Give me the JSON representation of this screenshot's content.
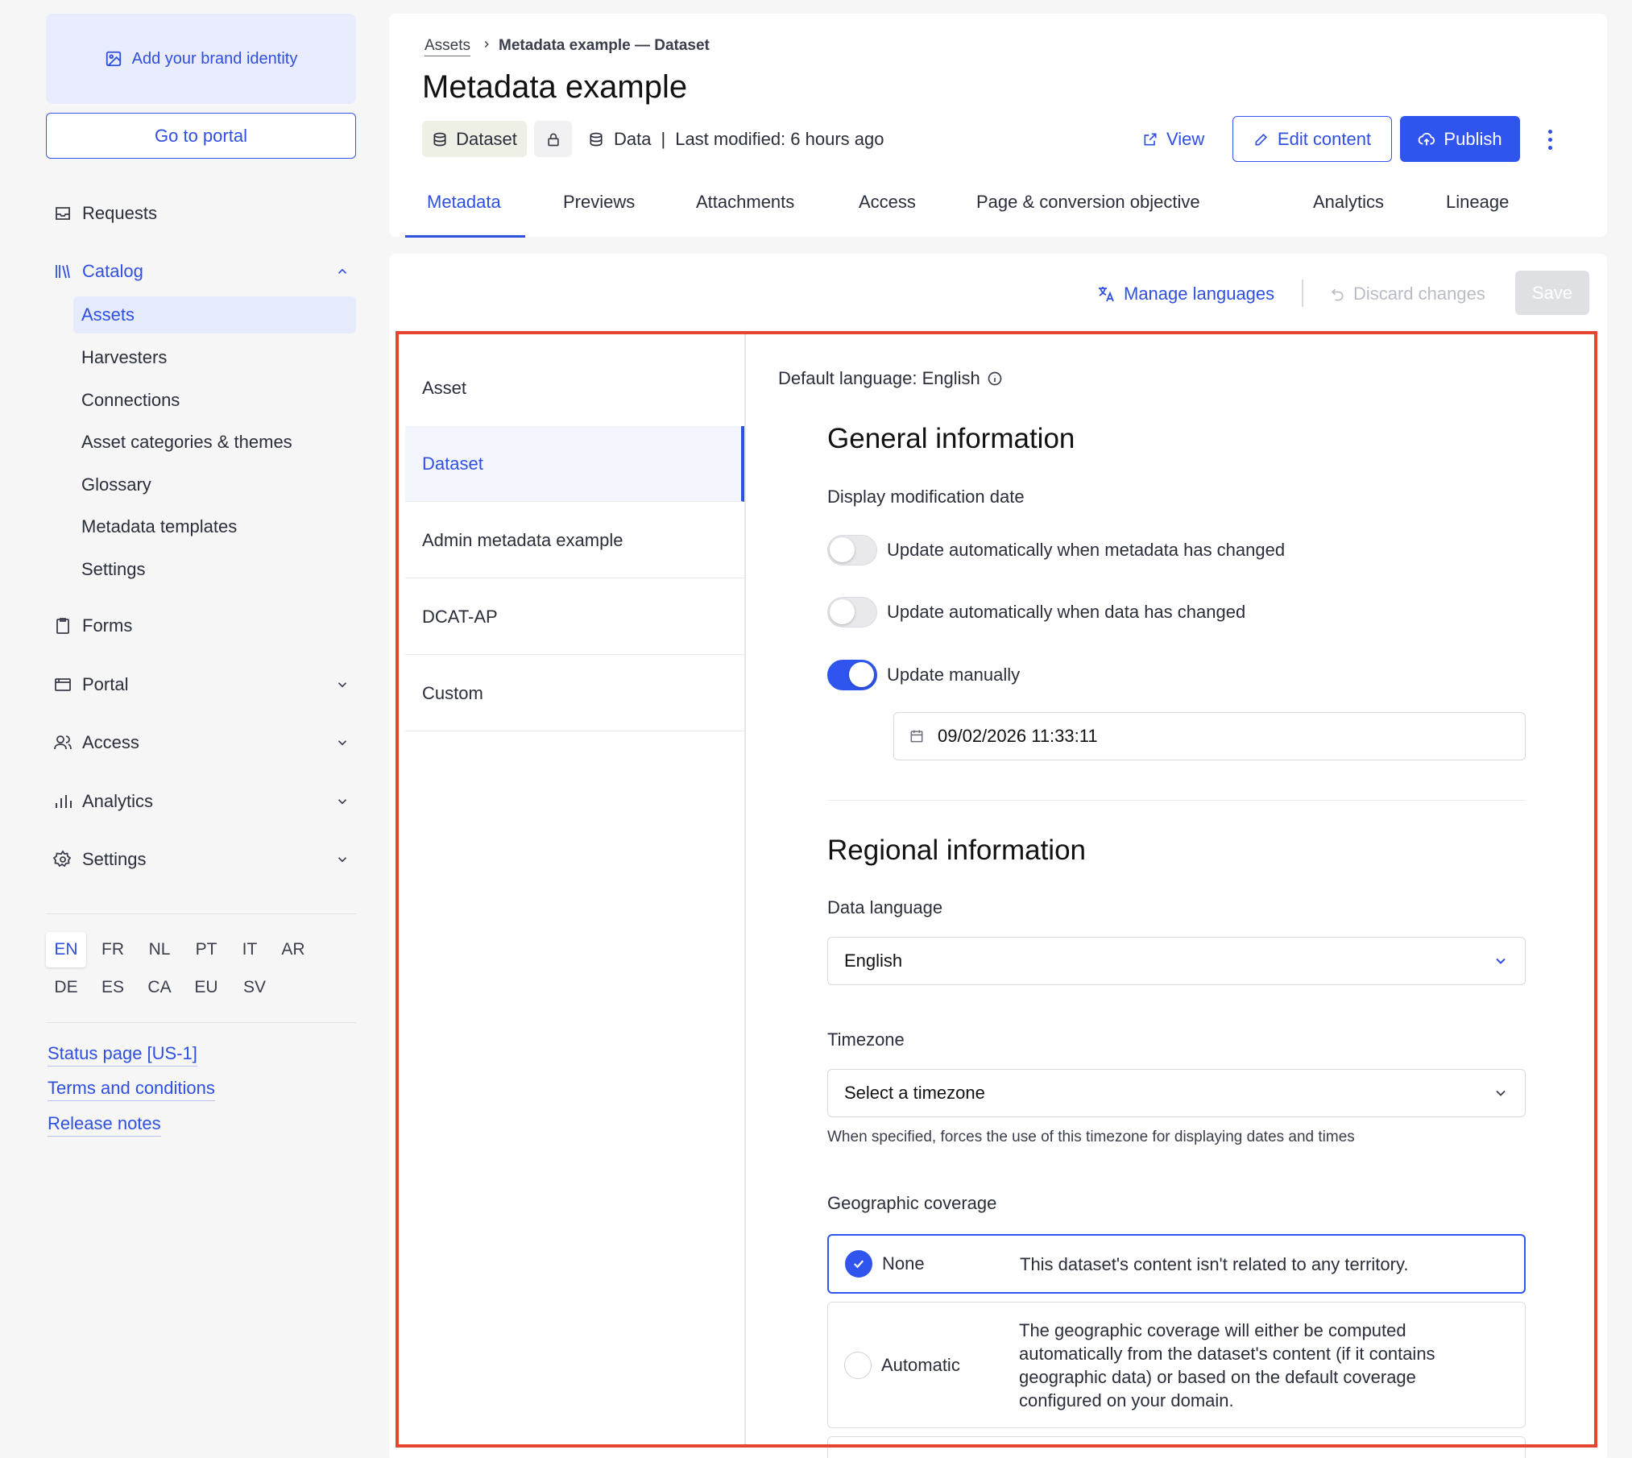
{
  "sidebar": {
    "brand_label": "Add your brand identity",
    "portal_button": "Go to portal",
    "nav": {
      "requests": "Requests",
      "catalog": "Catalog",
      "catalog_items": [
        "Assets",
        "Harvesters",
        "Connections",
        "Asset categories & themes",
        "Glossary",
        "Metadata templates",
        "Settings"
      ],
      "forms": "Forms",
      "portal": "Portal",
      "access": "Access",
      "analytics": "Analytics",
      "settings": "Settings"
    },
    "languages_row1": [
      "EN",
      "FR",
      "NL",
      "PT",
      "IT",
      "AR"
    ],
    "languages_row2": [
      "DE",
      "ES",
      "CA",
      "EU",
      "SV"
    ],
    "active_language": "EN",
    "footer_links": [
      "Status page [US-1]",
      "Terms and conditions",
      "Release notes"
    ]
  },
  "header": {
    "breadcrumb": [
      "Assets",
      "Metadata example — Dataset"
    ],
    "title": "Metadata example",
    "type_tag": "Dataset",
    "data_label": "Data",
    "meta_separator": "|",
    "last_modified": "Last modified: 6 hours ago",
    "view_label": "View",
    "edit_label": "Edit content",
    "publish_label": "Publish",
    "tabs": [
      "Metadata",
      "Previews",
      "Attachments",
      "Access",
      "Page & conversion objective",
      "Analytics",
      "Lineage"
    ],
    "active_tab": "Metadata"
  },
  "toolbar": {
    "manage_languages": "Manage languages",
    "discard_changes": "Discard changes",
    "save": "Save"
  },
  "sections": [
    "Asset",
    "Dataset",
    "Admin metadata example",
    "DCAT-AP",
    "Custom"
  ],
  "active_section": "Dataset",
  "form": {
    "default_language": "Default language: English",
    "general": {
      "heading": "General information",
      "modification_label": "Display modification date",
      "toggles": [
        {
          "label": "Update automatically when metadata has changed",
          "on": false
        },
        {
          "label": "Update automatically when data has changed",
          "on": false
        },
        {
          "label": "Update manually",
          "on": true
        }
      ],
      "date_value": "09/02/2026 11:33:11"
    },
    "regional": {
      "heading": "Regional information",
      "data_language_label": "Data language",
      "data_language_value": "English",
      "timezone_label": "Timezone",
      "timezone_placeholder": "Select a timezone",
      "timezone_help": "When specified, forces the use of this timezone for displaying dates and times",
      "geo_label": "Geographic coverage",
      "geo_options": [
        {
          "name": "None",
          "desc": "This dataset's content isn't related to any territory.",
          "selected": true
        },
        {
          "name": "Automatic",
          "desc": "The geographic coverage will either be computed automatically from the dataset's content (if it contains geographic data) or based on the default coverage configured on your domain.",
          "selected": false
        }
      ]
    }
  },
  "colors": {
    "accent": "#2f55ee",
    "highlight_frame": "#e4452f"
  }
}
